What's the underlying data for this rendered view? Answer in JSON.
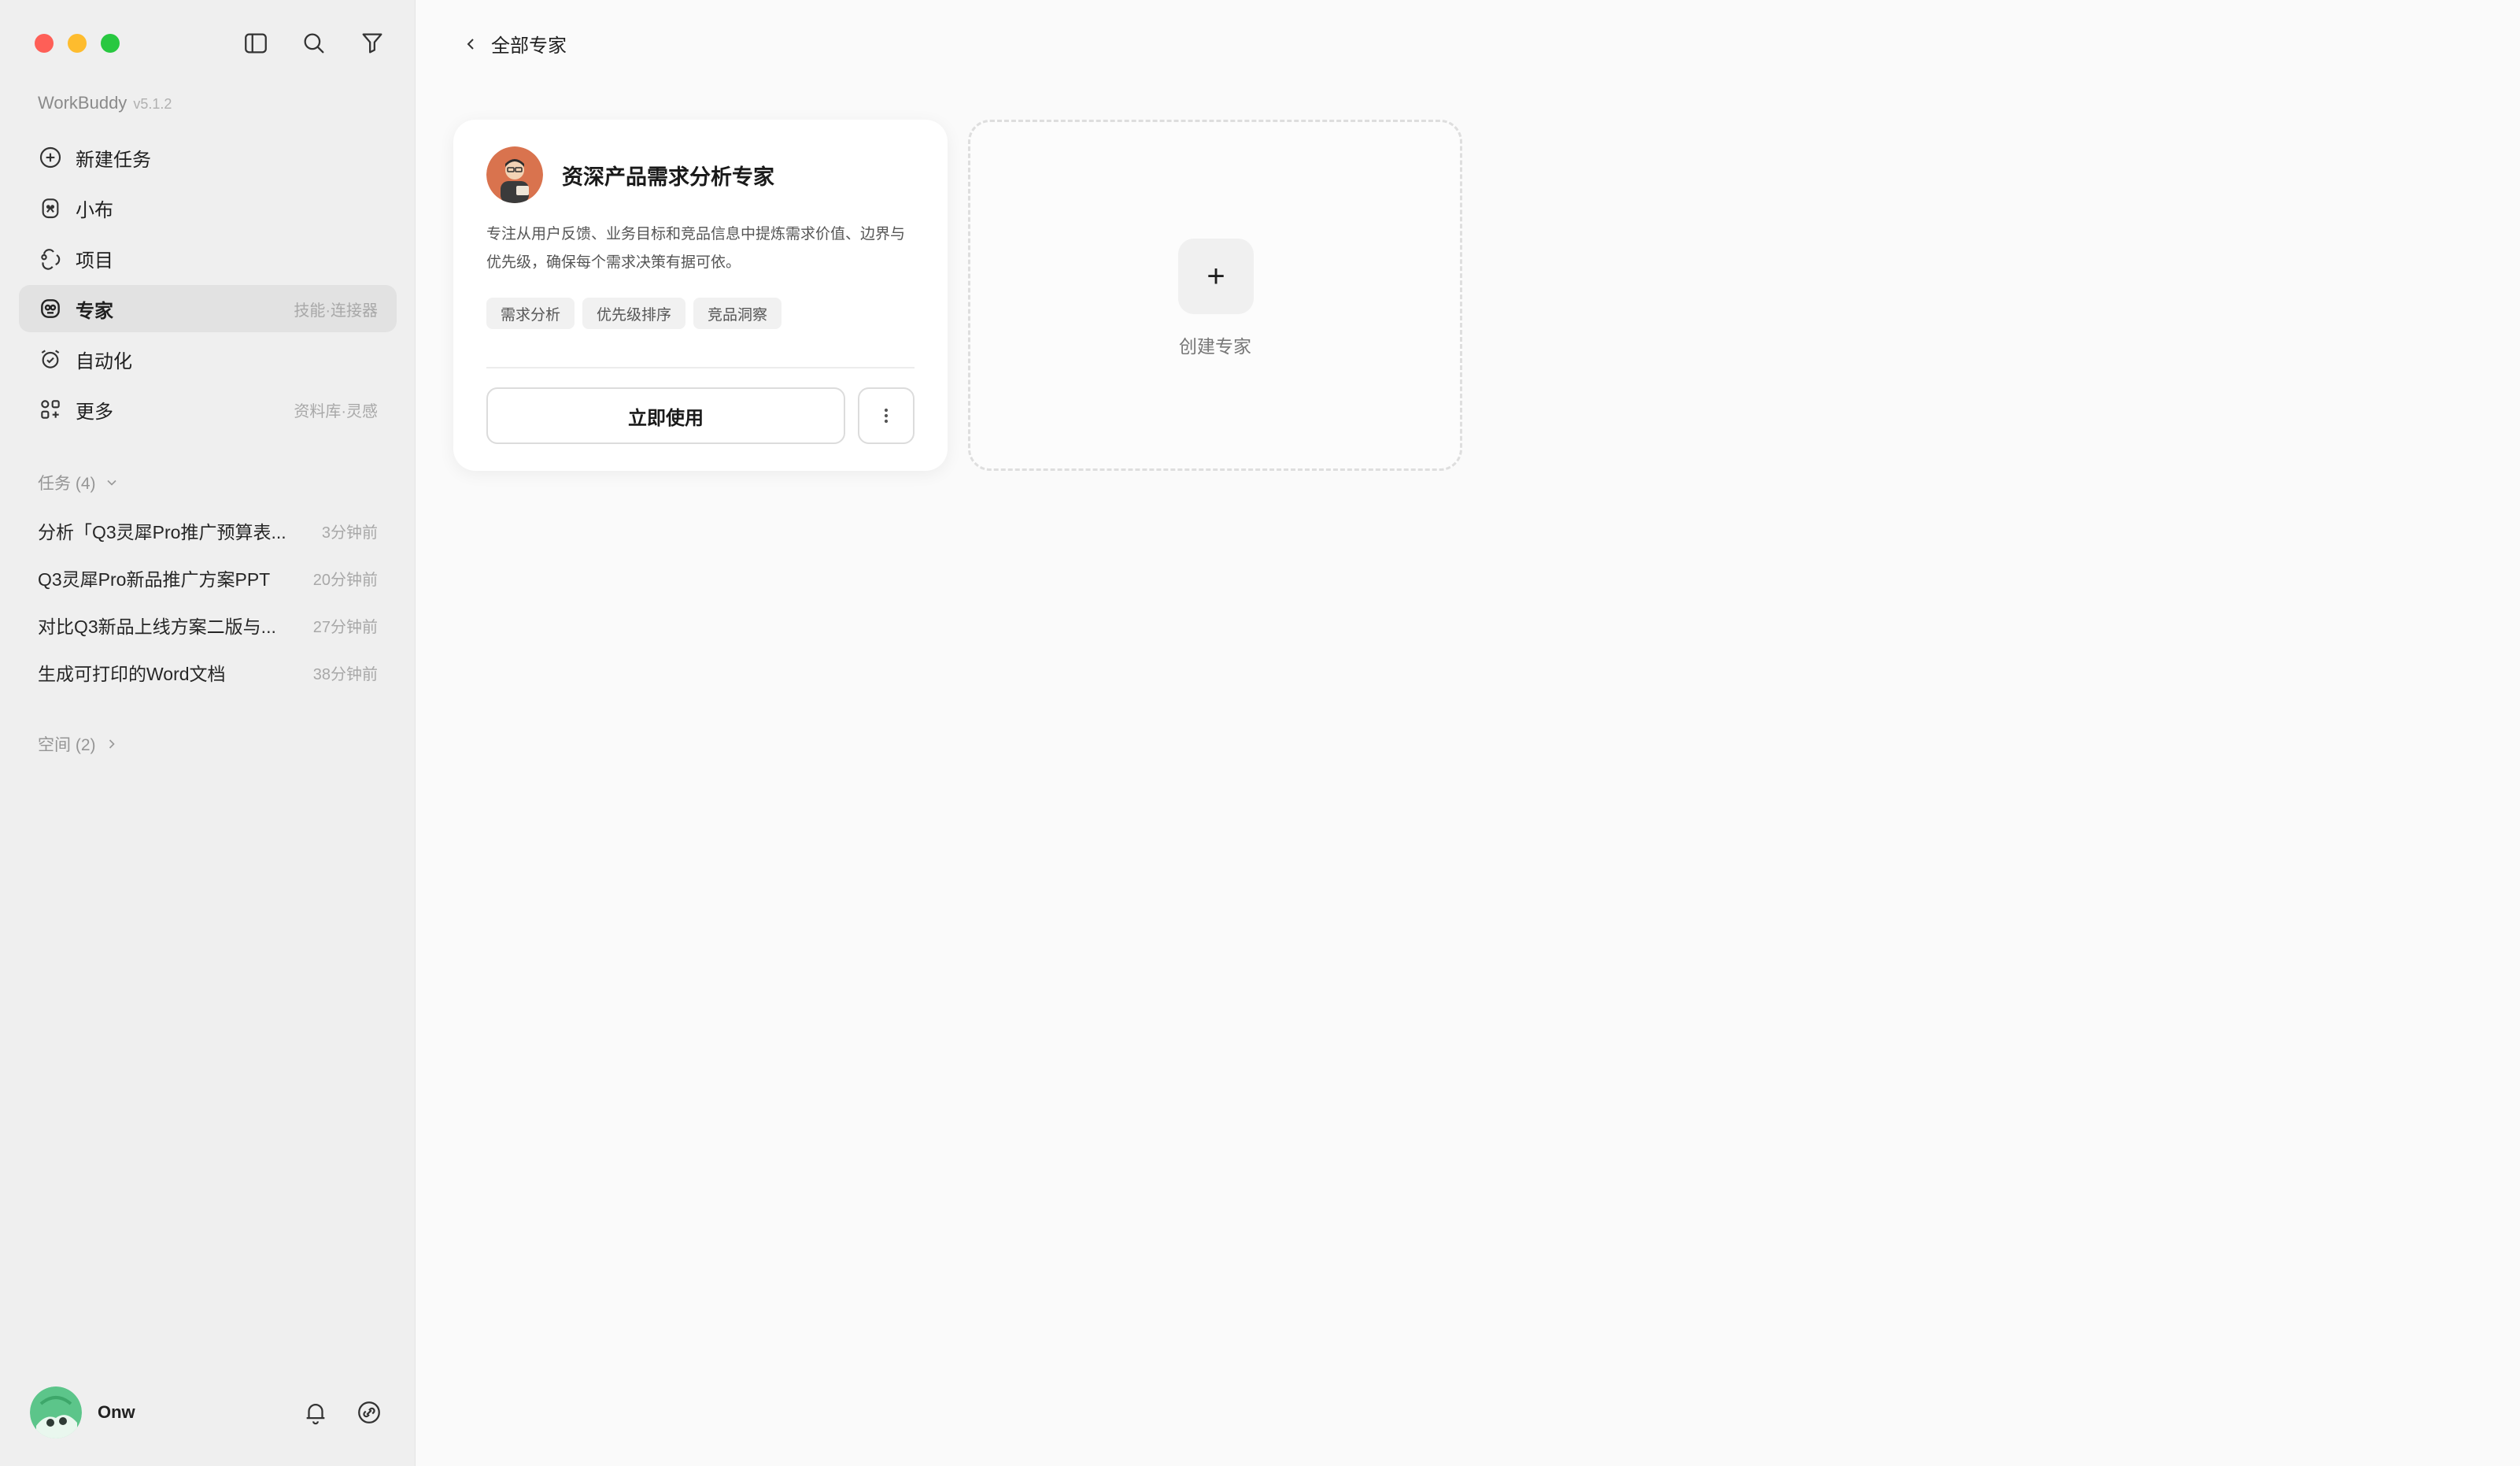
{
  "sidebar": {
    "brand": {
      "name": "WorkBuddy",
      "version": "v5.1.2"
    },
    "nav": [
      {
        "label": "新建任务",
        "hint": ""
      },
      {
        "label": "小布",
        "hint": ""
      },
      {
        "label": "项目",
        "hint": ""
      },
      {
        "label": "专家",
        "hint": "技能·连接器",
        "active": true
      },
      {
        "label": "自动化",
        "hint": ""
      },
      {
        "label": "更多",
        "hint": "资料库·灵感"
      }
    ],
    "tasks_header": "任务 (4)",
    "tasks": [
      {
        "title": "分析「Q3灵犀Pro推广预算表...",
        "time": "3分钟前"
      },
      {
        "title": "Q3灵犀Pro新品推广方案PPT",
        "time": "20分钟前"
      },
      {
        "title": "对比Q3新品上线方案二版与...",
        "time": "27分钟前"
      },
      {
        "title": "生成可打印的Word文档",
        "time": "38分钟前"
      }
    ],
    "spaces_header": "空间 (2)",
    "user": {
      "name": "Onw"
    }
  },
  "main": {
    "back_label": "全部专家",
    "expert_card": {
      "title": "资深产品需求分析专家",
      "description": "专注从用户反馈、业务目标和竞品信息中提炼需求价值、边界与优先级，确保每个需求决策有据可依。",
      "tags": [
        "需求分析",
        "优先级排序",
        "竞品洞察"
      ],
      "use_label": "立即使用"
    },
    "create_card": {
      "plus": "+",
      "label": "创建专家"
    }
  },
  "icons": {
    "window_controls": [
      "close",
      "minimize",
      "maximize"
    ],
    "top_tools": [
      "sidebar-toggle-icon",
      "search-icon",
      "filter-icon"
    ],
    "nav": [
      "plus-circle-icon",
      "robot-icon",
      "project-icon",
      "expert-icon",
      "alarm-clock-icon",
      "apps-icon"
    ],
    "user_tools": [
      "bell-icon",
      "link-icon"
    ]
  },
  "colors": {
    "close": "#fe5f57",
    "minimize": "#febc2e",
    "maximize": "#28c840",
    "sidebar_bg": "#efefef",
    "active_nav": "#e2e2e2"
  }
}
